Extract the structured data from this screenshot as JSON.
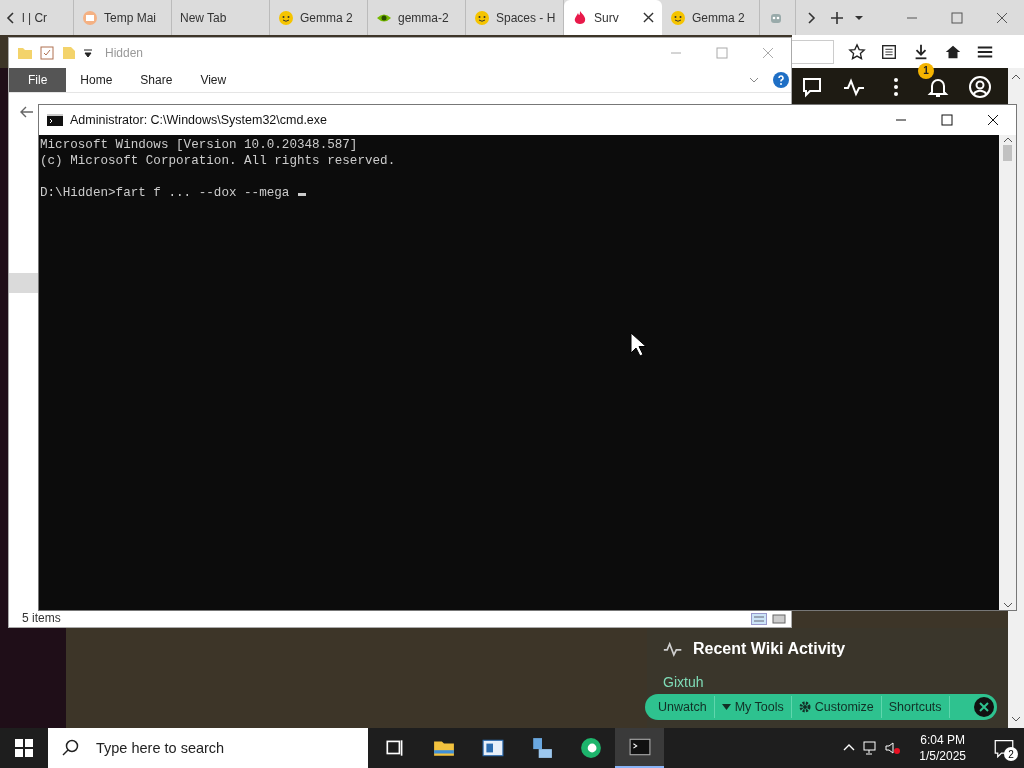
{
  "browser": {
    "tabs": [
      {
        "label": "l | Cr",
        "kind": "none",
        "selected": false
      },
      {
        "label": "Temp Mai",
        "kind": "mail",
        "selected": false
      },
      {
        "label": "New Tab",
        "kind": "none",
        "selected": false
      },
      {
        "label": "Gemma 2",
        "kind": "face",
        "selected": false
      },
      {
        "label": "gemma-2",
        "kind": "chip",
        "selected": false
      },
      {
        "label": "Spaces - H",
        "kind": "face",
        "selected": false
      },
      {
        "label": "Surv",
        "kind": "fire",
        "selected": true
      },
      {
        "label": "Gemma 2",
        "kind": "face",
        "selected": false
      },
      {
        "kind": "robot",
        "selected": false
      }
    ],
    "notification_badge": "1"
  },
  "wiki_panel": {
    "title": "Recent Wiki Activity",
    "entries": [
      "Gixtuh"
    ]
  },
  "wiki_toolbar": {
    "buttons": [
      {
        "label": "Unwatch",
        "kind": "plain"
      },
      {
        "label": "My Tools",
        "kind": "menu"
      },
      {
        "label": "Customize",
        "kind": "gear"
      },
      {
        "label": "Shortcuts",
        "kind": "plain"
      }
    ]
  },
  "explorer": {
    "title": "Hidden",
    "ribbon_tabs": [
      {
        "label": "File",
        "kind": "file"
      },
      {
        "label": "Home",
        "kind": "tab"
      },
      {
        "label": "Share",
        "kind": "tab"
      },
      {
        "label": "View",
        "kind": "tab"
      }
    ],
    "status": "5 items"
  },
  "cmd": {
    "title": "Administrator: C:\\Windows\\System32\\cmd.exe",
    "output": [
      "Microsoft Windows [Version 10.0.20348.587]",
      "(c) Microsoft Corporation. All rights reserved."
    ],
    "prompt": "D:\\Hidden>fart f ... --dox --mega "
  },
  "taskbar": {
    "search": {
      "placeholder": "Type here to search"
    },
    "apps": [
      {
        "kind": "taskview",
        "selected": false
      },
      {
        "kind": "folder",
        "selected": false
      },
      {
        "kind": "board",
        "selected": false
      },
      {
        "kind": "server",
        "selected": false
      },
      {
        "kind": "browser",
        "selected": false
      },
      {
        "kind": "terminal",
        "selected": true
      }
    ],
    "time": "6:04 PM",
    "date": "1/5/2025",
    "notifications": "2"
  }
}
